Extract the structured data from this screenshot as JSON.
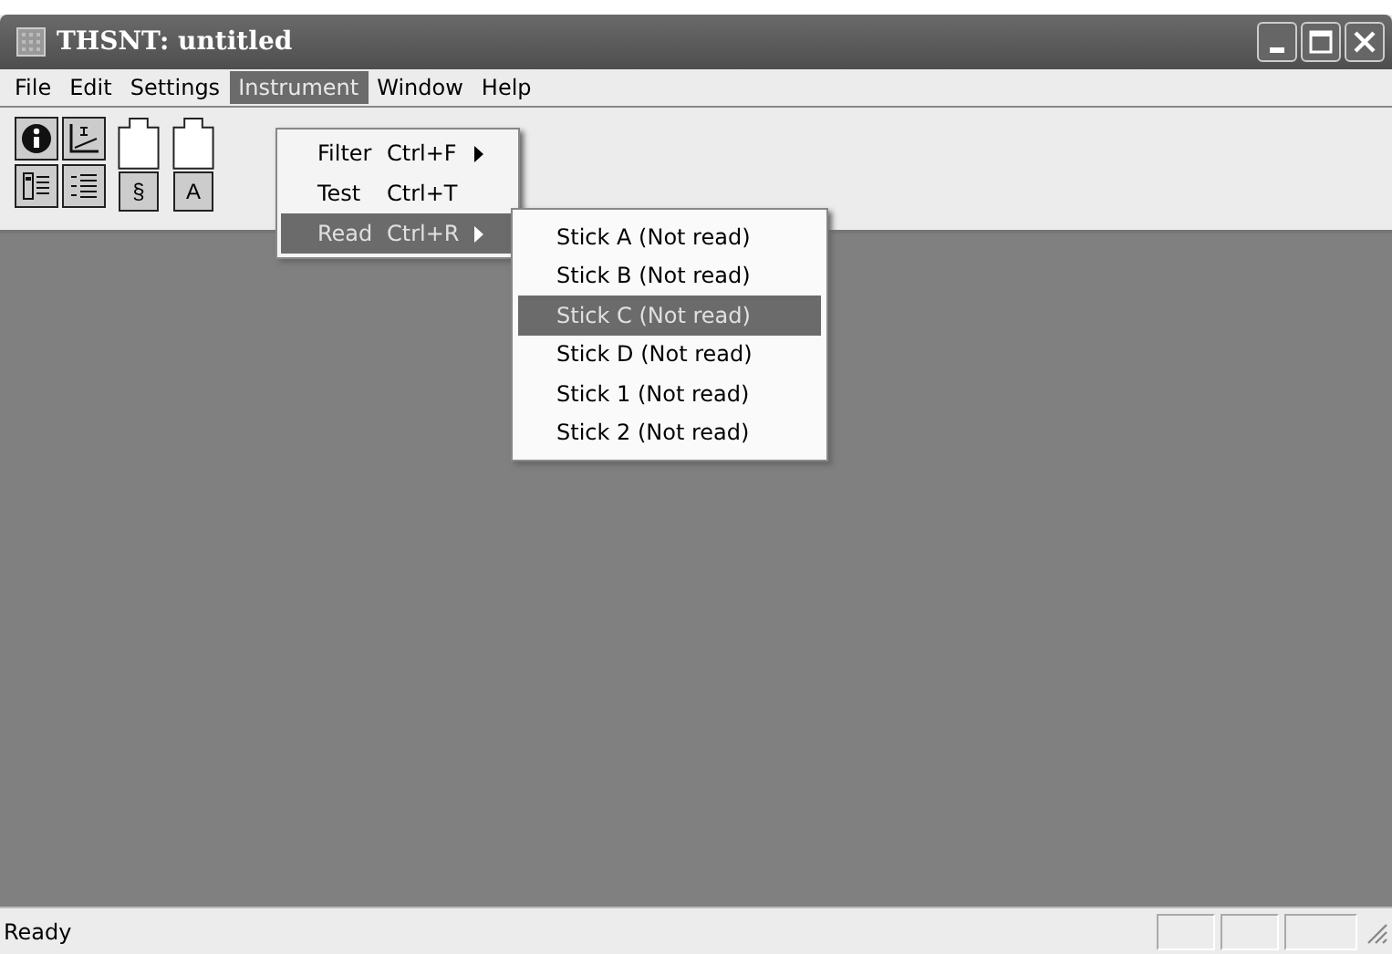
{
  "window": {
    "title": "THSNT: untitled"
  },
  "menu_bar": [
    {
      "label": "File",
      "selected": false
    },
    {
      "label": "Edit",
      "selected": false
    },
    {
      "label": "Settings",
      "selected": false
    },
    {
      "label": "Instrument",
      "selected": true
    },
    {
      "label": "Window",
      "selected": false
    },
    {
      "label": "Help",
      "selected": false
    }
  ],
  "toolbar": {
    "tall_buttons": [
      "§",
      "A"
    ]
  },
  "dropdown_menu": [
    {
      "label": "Filter",
      "shortcut": "Ctrl+F",
      "submenu": true,
      "selected": false
    },
    {
      "label": "Test",
      "shortcut": "Ctrl+T",
      "submenu": false,
      "selected": false
    },
    {
      "label": "Read",
      "shortcut": "Ctrl+R",
      "submenu": true,
      "selected": true
    }
  ],
  "submenu": [
    {
      "label": "Stick A (Not read)",
      "selected": false
    },
    {
      "label": "Stick B (Not read)",
      "selected": false
    },
    {
      "label": "Stick C (Not read)",
      "selected": true
    },
    {
      "label": "Stick D (Not read)",
      "selected": false
    },
    {
      "label": "Stick 1 (Not read)",
      "selected": false
    },
    {
      "label": "Stick 2 (Not read)",
      "selected": false
    }
  ],
  "status_bar": {
    "text": "Ready"
  }
}
